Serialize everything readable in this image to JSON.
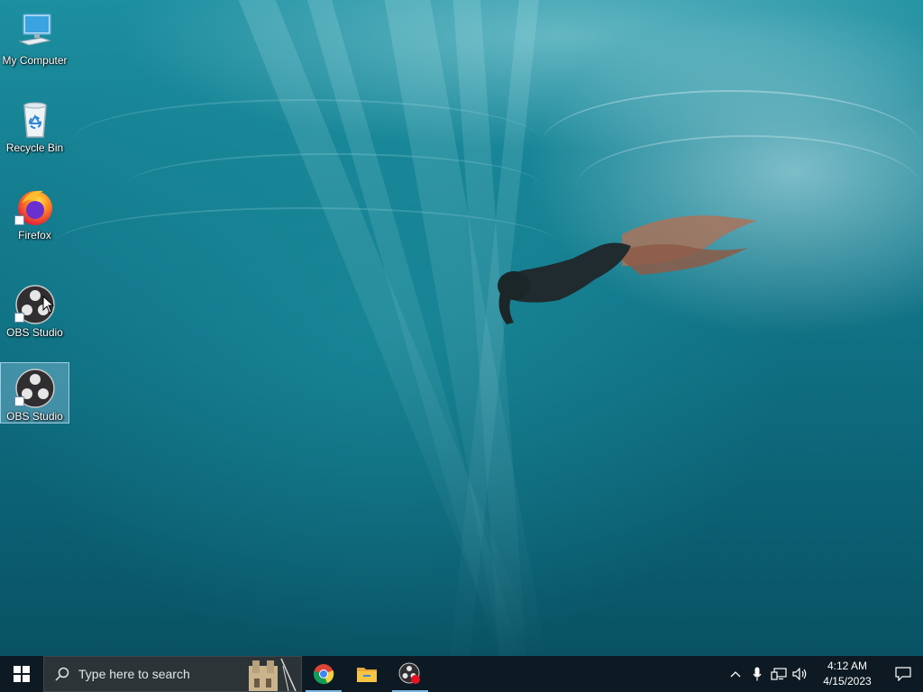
{
  "desktop": {
    "icons": [
      {
        "label": "My Computer",
        "icon": "computer-icon"
      },
      {
        "label": "Recycle Bin",
        "icon": "recycle-bin-icon"
      },
      {
        "label": "Firefox",
        "icon": "firefox-icon"
      },
      {
        "label": "OBS Studio",
        "icon": "obs-studio-icon"
      },
      {
        "label": "OBS Studio",
        "icon": "obs-studio-icon"
      }
    ]
  },
  "taskbar": {
    "search": {
      "placeholder": "Type here to search"
    },
    "pinned": [
      {
        "name": "Google Chrome",
        "icon": "chrome-icon"
      },
      {
        "name": "File Explorer",
        "icon": "folder-icon"
      },
      {
        "name": "OBS Studio",
        "icon": "obs-studio-icon"
      }
    ],
    "clock": {
      "time": "4:12 AM",
      "date": "4/15/2023"
    }
  },
  "colors": {
    "taskbar": "#0d1a23",
    "search_box": "#2d3438",
    "accent": "#7ab6e0",
    "water": "#157f91"
  }
}
